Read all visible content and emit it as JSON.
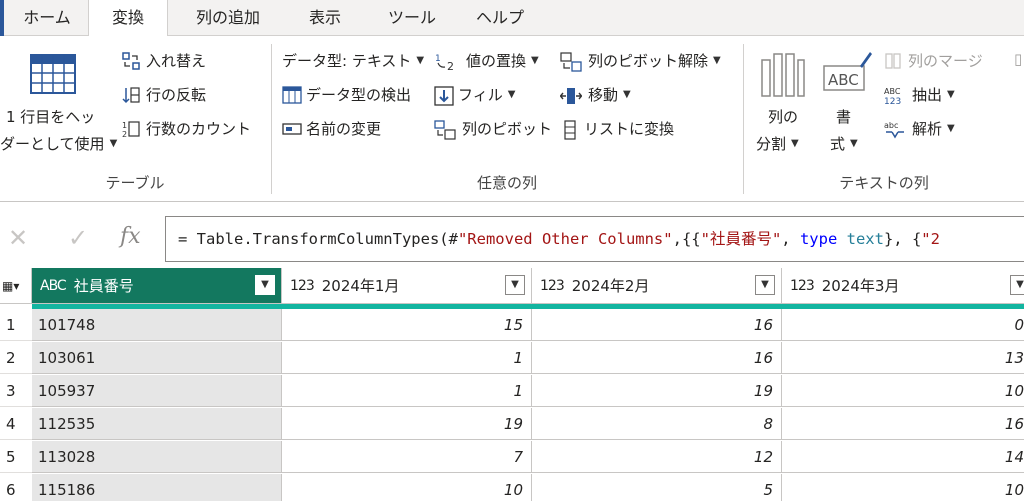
{
  "tabs": [
    "ホーム",
    "変換",
    "列の追加",
    "表示",
    "ツール",
    "ヘルプ"
  ],
  "ribbon": {
    "table_group": {
      "label": "テーブル",
      "use_first_row_line1": "1 行目をヘッ",
      "use_first_row_line2": "ダーとして使用",
      "transpose": "入れ替え",
      "reverse_rows": "行の反転",
      "count_rows": "行数のカウント"
    },
    "any_column_group": {
      "label": "任意の列",
      "data_type": "データ型: テキスト",
      "detect_type": "データ型の検出",
      "rename": "名前の変更",
      "replace_values": "値の置換",
      "fill": "フィル",
      "pivot_column": "列のピボット",
      "unpivot": "列のピボット解除",
      "move": "移動",
      "to_list": "リストに変換"
    },
    "text_column_group": {
      "label": "テキストの列",
      "split_line1": "列の",
      "split_line2": "分割",
      "format_line1": "書",
      "format_line2": "式",
      "merge": "列のマージ",
      "extract": "抽出",
      "parse": "解析",
      "abc_icon_text": "ABC",
      "abc123_top": "ABC",
      "abc123_bottom": "123",
      "num_icon_1": "1",
      "num_icon_2": "2"
    }
  },
  "formula": {
    "cancel_glyph": "✕",
    "commit_glyph": "✓",
    "fx_glyph": "fx",
    "p1": "= Table.TransformColumnTypes(#",
    "s1": "\"Removed Other Columns\"",
    "p2": ",{{",
    "s2": "\"社員番号\"",
    "p3": ", ",
    "kw": "type",
    "sp": " ",
    "ty": "text",
    "p4": "}, {",
    "s3": "\"2"
  },
  "grid": {
    "columns": [
      {
        "type_icon": "ABC",
        "name": "社員番号"
      },
      {
        "type_icon": "123",
        "name": "2024年1月"
      },
      {
        "type_icon": "123",
        "name": "2024年2月"
      },
      {
        "type_icon": "123",
        "name": "2024年3月"
      }
    ],
    "rows": [
      {
        "n": "1",
        "id": "101748",
        "m1": "15",
        "m2": "16",
        "m3": "0"
      },
      {
        "n": "2",
        "id": "103061",
        "m1": "1",
        "m2": "16",
        "m3": "13"
      },
      {
        "n": "3",
        "id": "105937",
        "m1": "1",
        "m2": "19",
        "m3": "10"
      },
      {
        "n": "4",
        "id": "112535",
        "m1": "19",
        "m2": "8",
        "m3": "16"
      },
      {
        "n": "5",
        "id": "113028",
        "m1": "7",
        "m2": "12",
        "m3": "14"
      },
      {
        "n": "6",
        "id": "115186",
        "m1": "10",
        "m2": "5",
        "m3": "10"
      }
    ]
  },
  "colors": {
    "accent": "#13785f",
    "quality_bar": "#13b5a0",
    "brand_blue": "#2b579a"
  }
}
